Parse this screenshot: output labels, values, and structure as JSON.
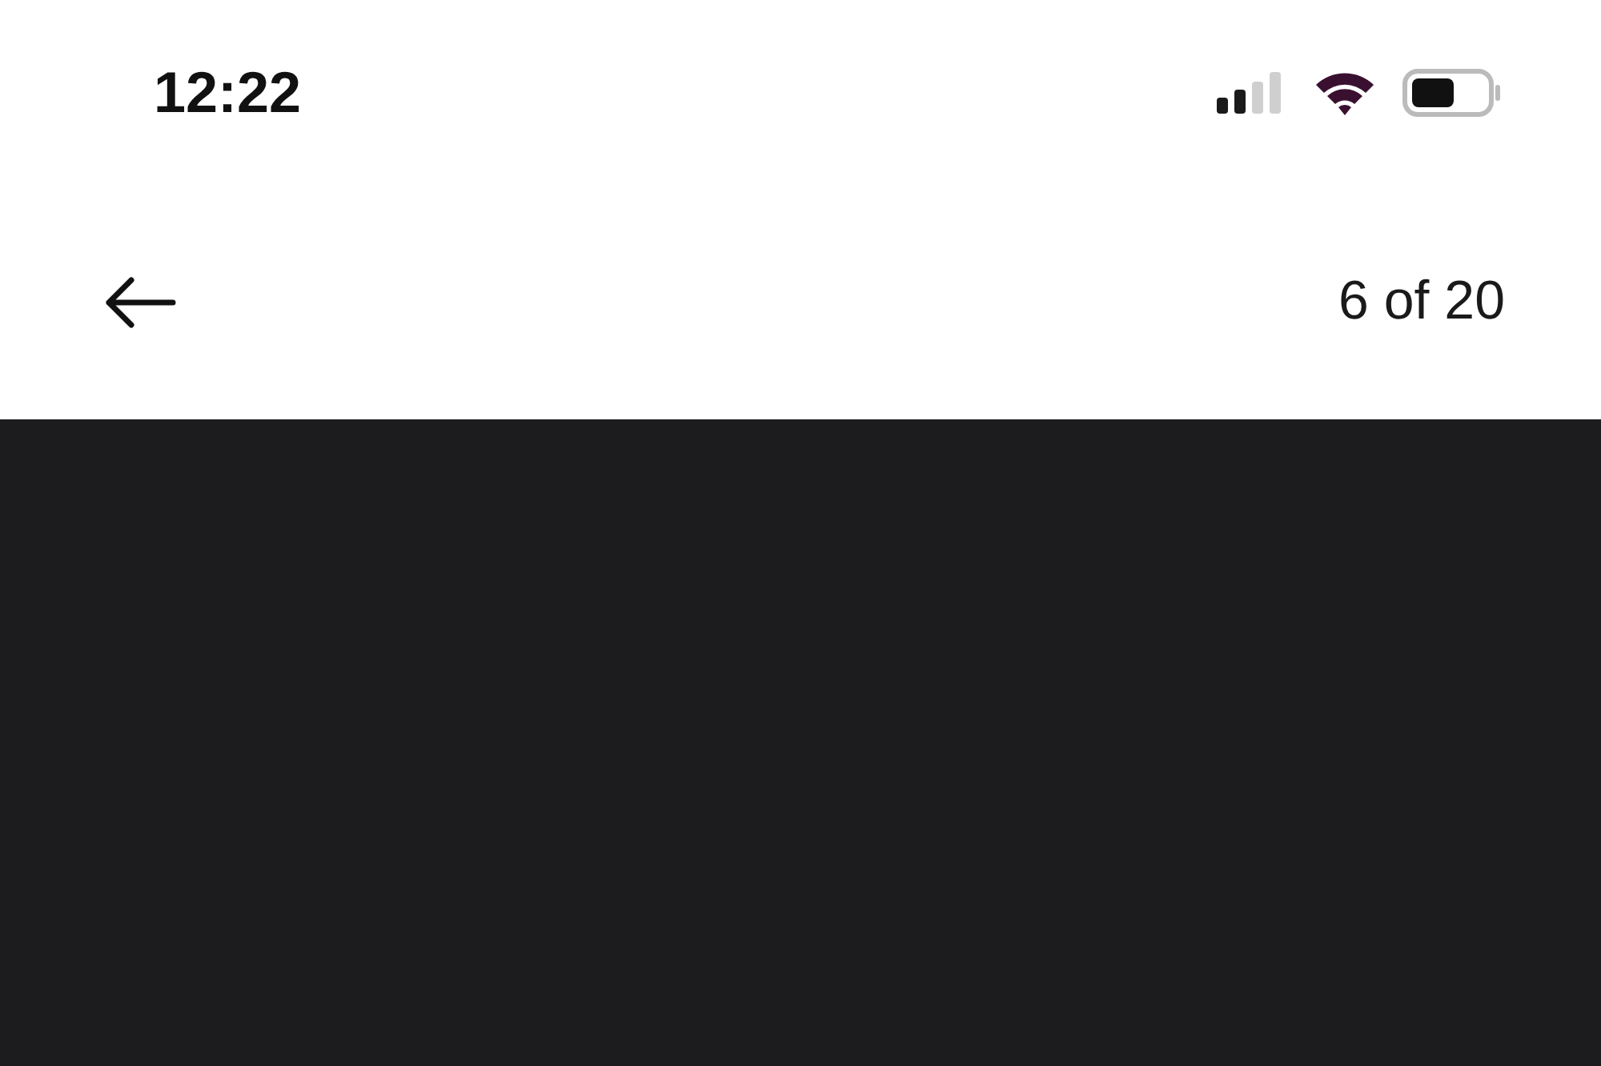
{
  "status_bar": {
    "time": "12:22"
  },
  "nav_bar": {
    "counter": "6 of 20"
  }
}
